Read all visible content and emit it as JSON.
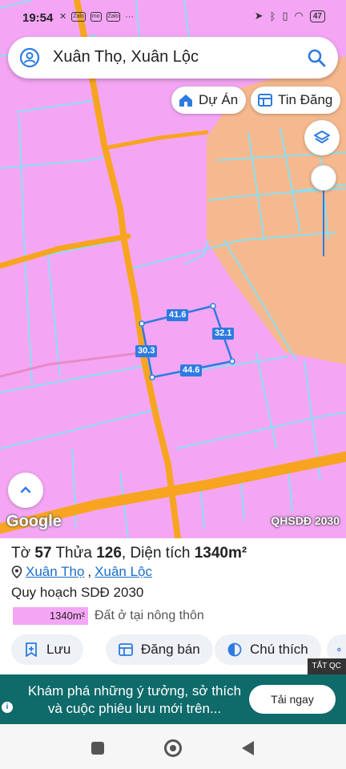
{
  "status_bar": {
    "time": "19:54",
    "left_icons": [
      "mute-icon",
      "zalo-icon",
      "momo-icon",
      "zalo-icon",
      "more-icon"
    ],
    "battery": "47"
  },
  "search": {
    "text": "Xuân Thọ, Xuân Lộc"
  },
  "chips": {
    "du_an": "Dự Án",
    "tin_dang": "Tin Đăng"
  },
  "map": {
    "edge_labels": {
      "top": "41.6",
      "right": "32.1",
      "left": "30.3",
      "bottom": "44.6"
    },
    "attribution": "Google",
    "overlay_tag": "QHSDĐ 2030",
    "colors": {
      "residential": "#f4a6f4",
      "agricultural": "#f6b98f",
      "road": "#f7a520",
      "parcel_outline": "#8ae0f2",
      "selection": "#2d7be0"
    }
  },
  "parcel": {
    "to_label": "Tờ",
    "to_value": "57",
    "thua_label": "Thửa",
    "thua_value": "126",
    "area_label": "Diện tích",
    "area_value": "1340m²",
    "location_ward": "Xuân Thọ",
    "location_district": "Xuân Lộc",
    "plan_title": "Quy hoạch SDĐ 2030",
    "legend_area": "1340m²",
    "legend_text": "Đất ở tại nông thôn"
  },
  "actions": {
    "save": "Lưu",
    "post_sale": "Đăng bán",
    "notes": "Chú thích"
  },
  "ad": {
    "close_label": "TẮT QC",
    "text": "Khám phá những ý tưởng, sở thích và cuộc phiêu lưu mới trên...",
    "button": "Tải ngay"
  }
}
